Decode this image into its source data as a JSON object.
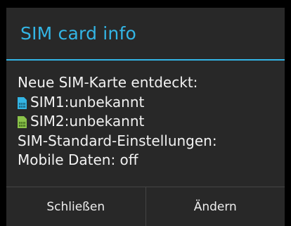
{
  "dialog": {
    "title": "SIM card info",
    "lines": {
      "intro": "Neue SIM-Karte entdeckt:",
      "sim1": "SIM1:unbekannt",
      "sim2": "SIM2:unbekannt",
      "defaults": "SIM-Standard-Einstellungen:",
      "mobile_data": "Mobile Daten: off"
    },
    "icons": {
      "sim1": {
        "name": "sim-card-icon",
        "color": "#33b5e5"
      },
      "sim2": {
        "name": "sim-card-icon",
        "color": "#8bc34a"
      }
    },
    "buttons": {
      "close": "Schließen",
      "change": "Ändern"
    }
  },
  "colors": {
    "accent": "#33b5e5",
    "dialog_bg": "#282828",
    "backdrop": "#000000"
  }
}
